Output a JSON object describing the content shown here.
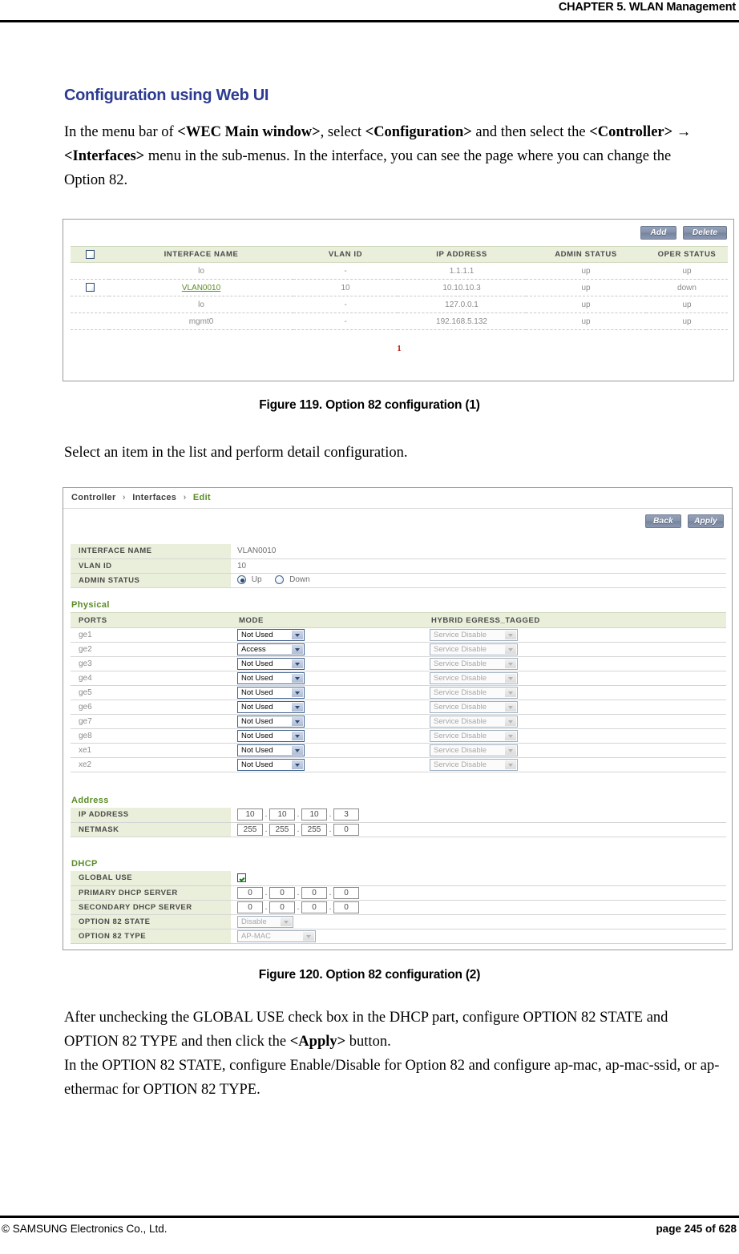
{
  "header": {
    "chapter": "CHAPTER 5. WLAN Management"
  },
  "footer": {
    "copyright": "© SAMSUNG Electronics Co., Ltd.",
    "page": "page 245 of 628"
  },
  "section": {
    "heading": "Configuration using Web UI",
    "intro_html": "In the menu bar of <b>&lt;WEC Main window&gt;</b>, select <b>&lt;Configuration&gt;</b> and then select the <b>&lt;Controller&gt; → &lt;Interfaces&gt;</b> menu in the sub-menus. In the interface, you can see the page where you can change the Option 82.",
    "select_item_text": "Select an item in the list and perform detail configuration.",
    "after_html": "After unchecking the GLOBAL USE check box in the DHCP part, configure OPTION 82 STATE and OPTION 82 TYPE and then click the <b>&lt;Apply&gt;</b> button.<br>In the OPTION 82 STATE, configure Enable/Disable for Option 82 and configure ap-mac, ap-mac-ssid, or ap-ethermac for OPTION 82 TYPE."
  },
  "figures": {
    "fig119_caption": "Figure 119. Option 82 configuration (1)",
    "fig120_caption": "Figure 120. Option 82 configuration (2)"
  },
  "interfaces_screen": {
    "buttons": {
      "add": "Add",
      "delete": "Delete"
    },
    "columns": [
      "INTERFACE NAME",
      "VLAN ID",
      "IP ADDRESS",
      "ADMIN STATUS",
      "OPER STATUS"
    ],
    "rows": [
      {
        "checkbox": false,
        "name": "lo",
        "vlan_id": "-",
        "ip": "1.1.1.1",
        "admin": "up",
        "oper": "up",
        "link": false
      },
      {
        "checkbox": true,
        "name": "VLAN0010",
        "vlan_id": "10",
        "ip": "10.10.10.3",
        "admin": "up",
        "oper": "down",
        "link": true
      },
      {
        "checkbox": false,
        "name": "lo",
        "vlan_id": "-",
        "ip": "127.0.0.1",
        "admin": "up",
        "oper": "up",
        "link": false
      },
      {
        "checkbox": false,
        "name": "mgmt0",
        "vlan_id": "-",
        "ip": "192.168.5.132",
        "admin": "up",
        "oper": "up",
        "link": false
      }
    ],
    "pager": "1"
  },
  "edit_screen": {
    "breadcrumb": {
      "item1": "Controller",
      "item2": "Interfaces",
      "current": "Edit"
    },
    "buttons": {
      "back": "Back",
      "apply": "Apply"
    },
    "general": {
      "interface_name_label": "INTERFACE NAME",
      "interface_name_value": "VLAN0010",
      "vlan_id_label": "VLAN ID",
      "vlan_id_value": "10",
      "admin_status_label": "ADMIN STATUS",
      "admin_up_label": "Up",
      "admin_down_label": "Down",
      "admin_selected": "Up"
    },
    "physical": {
      "title": "Physical",
      "columns": [
        "PORTS",
        "MODE",
        "HYBRID EGRESS_TAGGED"
      ],
      "rows": [
        {
          "port": "ge1",
          "mode": "Not Used",
          "hybrid": "Service Disable"
        },
        {
          "port": "ge2",
          "mode": "Access",
          "hybrid": "Service Disable"
        },
        {
          "port": "ge3",
          "mode": "Not Used",
          "hybrid": "Service Disable"
        },
        {
          "port": "ge4",
          "mode": "Not Used",
          "hybrid": "Service Disable"
        },
        {
          "port": "ge5",
          "mode": "Not Used",
          "hybrid": "Service Disable"
        },
        {
          "port": "ge6",
          "mode": "Not Used",
          "hybrid": "Service Disable"
        },
        {
          "port": "ge7",
          "mode": "Not Used",
          "hybrid": "Service Disable"
        },
        {
          "port": "ge8",
          "mode": "Not Used",
          "hybrid": "Service Disable"
        },
        {
          "port": "xe1",
          "mode": "Not Used",
          "hybrid": "Service Disable"
        },
        {
          "port": "xe2",
          "mode": "Not Used",
          "hybrid": "Service Disable"
        }
      ]
    },
    "address": {
      "title": "Address",
      "ip_label": "IP ADDRESS",
      "ip_octets": [
        "10",
        "10",
        "10",
        "3"
      ],
      "netmask_label": "NETMASK",
      "netmask_octets": [
        "255",
        "255",
        "255",
        "0"
      ]
    },
    "dhcp": {
      "title": "DHCP",
      "global_use_label": "GLOBAL USE",
      "global_use_checked": true,
      "primary_label": "PRIMARY DHCP SERVER",
      "primary_octets": [
        "0",
        "0",
        "0",
        "0"
      ],
      "secondary_label": "SECONDARY DHCP SERVER",
      "secondary_octets": [
        "0",
        "0",
        "0",
        "0"
      ],
      "option82_state_label": "OPTION 82 STATE",
      "option82_state_value": "Disable",
      "option82_type_label": "OPTION 82 TYPE",
      "option82_type_value": "AP-MAC"
    }
  }
}
